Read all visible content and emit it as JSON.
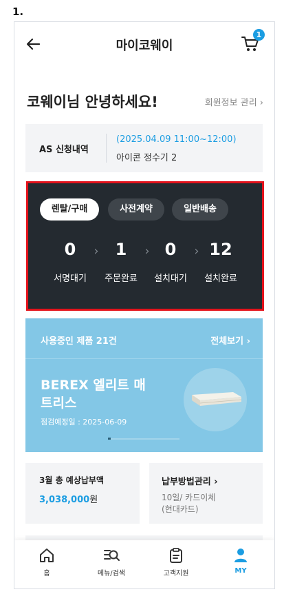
{
  "step_label": "1.",
  "header": {
    "title": "마이코웨이",
    "cart_badge": "1"
  },
  "greeting": {
    "text": "코웨이님 안녕하세요!",
    "member_link": "회원정보 관리 ›"
  },
  "as_request": {
    "label": "AS 신청내역",
    "time": "(2025.04.09 11:00~12:00)",
    "product": "아이콘 정수기 2"
  },
  "order_status": {
    "tabs": [
      {
        "label": "렌탈/구매",
        "active": true
      },
      {
        "label": "사전계약",
        "active": false
      },
      {
        "label": "일반배송",
        "active": false
      }
    ],
    "steps": [
      {
        "count": "0",
        "label": "서명대기"
      },
      {
        "count": "1",
        "label": "주문완료"
      },
      {
        "count": "0",
        "label": "설치대기"
      },
      {
        "count": "12",
        "label": "설치완료"
      }
    ],
    "arrow": "›"
  },
  "products": {
    "title": "사용중인 제품 21건",
    "view_all": "전체보기 ›",
    "name": "BEREX 엘리트 매트리스",
    "inspection": "점검예정일 : 2025-06-09"
  },
  "payment": {
    "monthly_title": "3월 총 예상납부액",
    "amount": "3,038,000",
    "unit": "원",
    "method_title": "납부방법관리 ›",
    "method_detail": "10일/ 카드이체",
    "method_card": "(현대카드)"
  },
  "tabbar": {
    "items": [
      {
        "label": "홈",
        "icon": "home-icon"
      },
      {
        "label": "메뉴/검색",
        "icon": "menu-search-icon"
      },
      {
        "label": "고객지원",
        "icon": "clipboard-icon"
      },
      {
        "label": "MY",
        "icon": "person-icon"
      }
    ]
  },
  "colors": {
    "accent": "#1b9de2",
    "dark_card": "#242a30",
    "highlight_border": "#e3121b",
    "product_bg": "#83c7e6"
  }
}
